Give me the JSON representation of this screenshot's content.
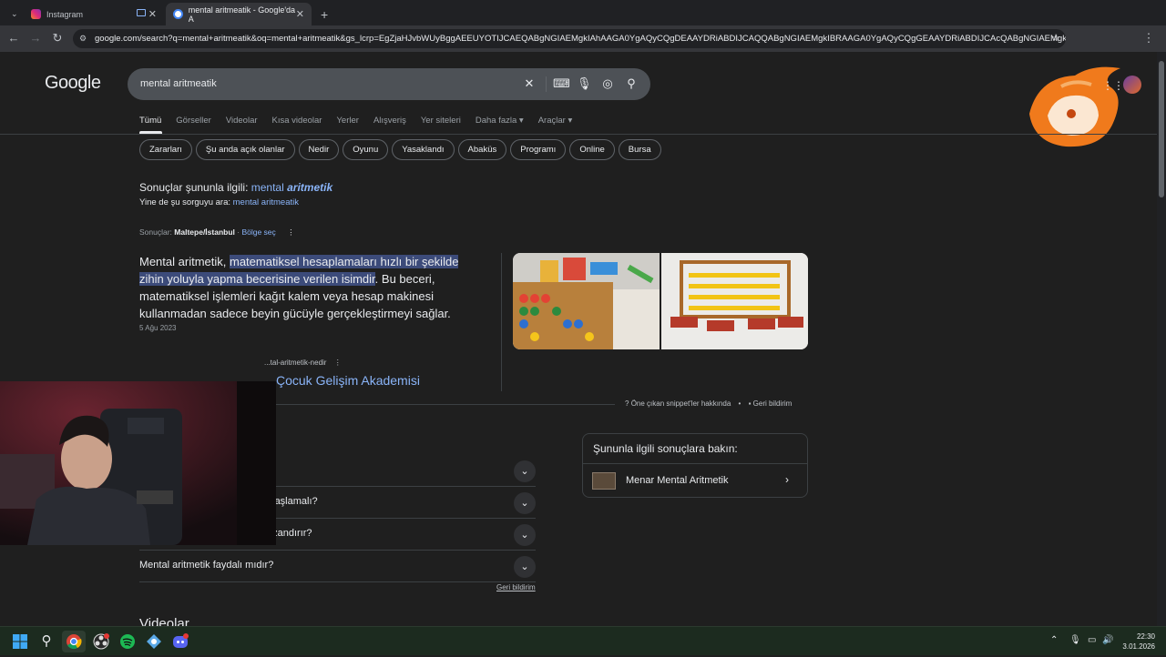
{
  "browser": {
    "tabs": [
      {
        "title": "Instagram"
      },
      {
        "title": ""
      },
      {
        "title": "mental aritmeatik - Google'da A"
      }
    ],
    "url": "google.com/search?q=mental+aritmeatik&oq=mental+aritmeatik&gs_lcrp=EgZjaHJvbWUyBggAEEUYOTIJCAEQABgNGIAEMgkIAhAAGA0YgAQyCQgDEAAYDRiABDIJCAQQABgNGIAEMgkIBRAAGA0YgAQyCQgGEAAYDRiABDIJCAcQABgNGIAEMgkICB..."
  },
  "google": {
    "logo": "Google",
    "query": "mental aritmeatik",
    "tabs": [
      "Tümü",
      "Görseller",
      "Videolar",
      "Kısa videolar",
      "Yerler",
      "Alışveriş",
      "Yer siteleri",
      "Daha fazla",
      "Araçlar"
    ],
    "chips": [
      "Zararları",
      "Şu anda açık olanlar",
      "Nedir",
      "Oyunu",
      "Yasaklandı",
      "Abaküs",
      "Programı",
      "Online",
      "Bursa"
    ],
    "correction": {
      "prefix": "Sonuçlar şununla ilgili:",
      "word1": "mental",
      "word2": "aritmetik",
      "instead_prefix": "Yine de şu sorguyu ara:",
      "instead_link": "mental aritmeatik"
    },
    "location": {
      "prefix": "Sonuçlar:",
      "place": "Maltepe/İstanbul",
      "link": "Bölge seç"
    },
    "snippet": {
      "start": "Mental aritmetik, ",
      "highlight": "matematiksel hesaplamaları hızlı bir şekilde zihin yoluyla yapma becerisine verilen isimdir",
      "rest": ". Bu beceri, matematiksel işlemleri kağıt kalem veya hesap makinesi kullanmadan sadece beyin gücüyle gerçekleştirmeyi sağlar.",
      "date": "5 Ağu 2023",
      "source_url": "...tal-aritmetik-nedir",
      "source_title": "Çocuk Gelişim Akademisi",
      "about": "Öne çıkan snippet'ler hakkında",
      "feedback": "Geri bildirim"
    },
    "faq": [
      "",
      "Mental aritmetik kaç yaşında başlamalı?",
      "Mental aritmetik çocuğa ne kazandırır?",
      "Mental aritmetik faydalı mıdır?"
    ],
    "faq_feedback": "Geri bildirim",
    "related": {
      "title": "Şununla ilgili sonuçlara bakın:",
      "item": "Menar Mental Aritmetik"
    },
    "next_section": "Videolar"
  },
  "taskbar": {
    "time": "22:30",
    "date": "3.01.2026"
  }
}
